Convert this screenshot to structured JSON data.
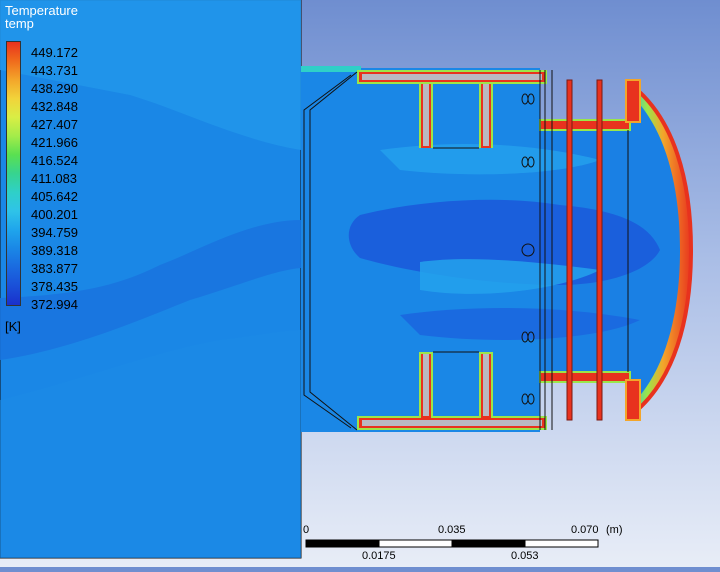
{
  "legend": {
    "title_line1": "Temperature",
    "title_line2": "temp",
    "unit": "[K]",
    "labels": [
      "449.172",
      "443.731",
      "438.290",
      "432.848",
      "427.407",
      "421.966",
      "416.524",
      "411.083",
      "405.642",
      "400.201",
      "394.759",
      "389.318",
      "383.877",
      "378.435",
      "372.994"
    ],
    "colors": [
      "#e8321e",
      "#f06b1c",
      "#f3a52a",
      "#f2d33a",
      "#d9ee45",
      "#a4ec4a",
      "#5ae051",
      "#37d48f",
      "#2fd0c8",
      "#2fc3e8",
      "#1fa5ec",
      "#1a87e6",
      "#1a6ae0",
      "#1a4fd8",
      "#1a30cc"
    ]
  },
  "scale": {
    "top_labels": [
      "0",
      "0.035",
      "0.070"
    ],
    "unit": "(m)",
    "bottom_labels": [
      "0.0175",
      "0.053"
    ]
  },
  "colors": {
    "background_top": "#6f8ed0",
    "background_bottom": "#e8edf7",
    "field_base": "#1a87e6",
    "field_light": "#2aa0ec",
    "field_dark": "#1a62dc",
    "hot": "#e8321e"
  }
}
